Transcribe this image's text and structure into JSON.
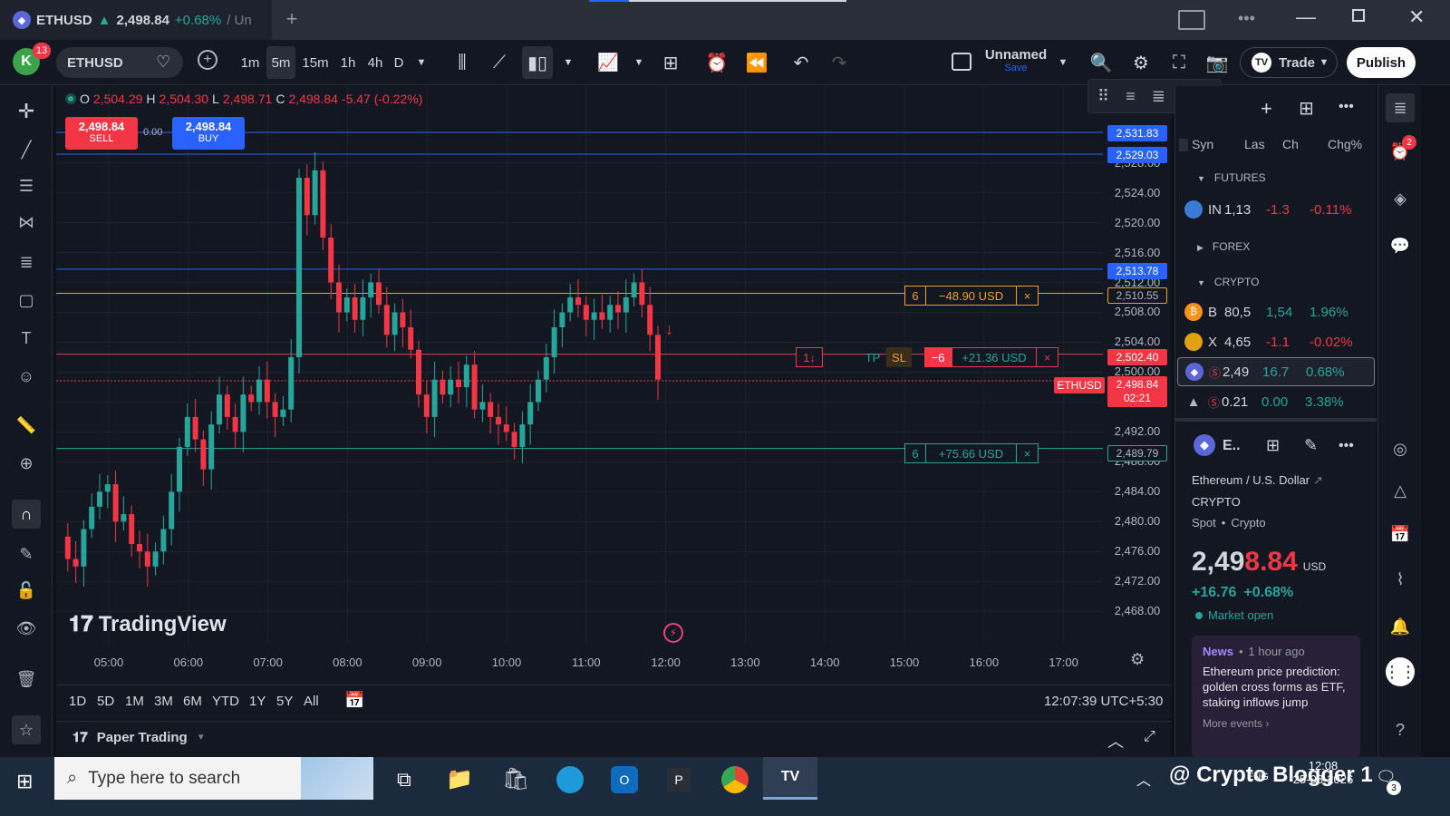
{
  "browser": {
    "tab_symbol": "ETHUSD",
    "tab_arrow": "▲",
    "tab_price": "2,498.84",
    "tab_change": "+0.68%",
    "tab_rest": "/ Un",
    "new_tab": "+"
  },
  "toolbar": {
    "avatar_letter": "K",
    "avatar_badge": "13",
    "symbol": "ETHUSD",
    "intervals": [
      "1m",
      "5m",
      "15m",
      "1h",
      "4h",
      "D"
    ],
    "active_interval": "5m",
    "layout_name": "Unnamed",
    "layout_save": "Save",
    "trade_label": "Trade",
    "publish_label": "Publish"
  },
  "ohlc": {
    "o_label": "O",
    "o": "2,504.29",
    "h_label": "H",
    "h": "2,504.30",
    "l_label": "L",
    "l": "2,498.71",
    "c_label": "C",
    "c": "2,498.84",
    "change": "-5.47 (-0.22%)"
  },
  "quick_trade": {
    "sell_price": "2,498.84",
    "sell_label": "SELL",
    "spread": "0.00",
    "buy_price": "2,498.84",
    "buy_label": "BUY"
  },
  "price_axis": {
    "ticks": [
      "2,528.00",
      "2,524.00",
      "2,520.00",
      "2,516.00",
      "2,512.00",
      "2,508.00",
      "2,504.00",
      "2,500.00",
      "2,496.00",
      "2,492.00",
      "2,488.00",
      "2,484.00",
      "2,480.00",
      "2,476.00",
      "2,472.00",
      "2,468.00"
    ],
    "labels": {
      "line1": "2,531.83",
      "line2": "2,529.03",
      "line3": "2,513.78",
      "tp_order": "2,510.55",
      "position": "2,502.40",
      "last": "2,498.84",
      "countdown": "02:21",
      "sl_order": "2,489.79"
    },
    "symbol_tag": "ETHUSD"
  },
  "orders": {
    "tp": {
      "qty": "6",
      "pnl": "−48.90 USD",
      "close": "×"
    },
    "position": {
      "side_icon": "1↓",
      "tp": "TP",
      "sl": "SL",
      "qty": "−6",
      "pnl": "+21.36 USD",
      "close": "×"
    },
    "sl": {
      "qty": "6",
      "pnl": "+75.66 USD",
      "close": "×"
    }
  },
  "watermark": "TradingView",
  "time_axis": [
    "05:00",
    "06:00",
    "07:00",
    "08:00",
    "09:00",
    "10:00",
    "11:00",
    "12:00",
    "13:00",
    "14:00",
    "15:00",
    "16:00",
    "17:00"
  ],
  "range_bar": {
    "ranges": [
      "1D",
      "5D",
      "1M",
      "3M",
      "6M",
      "YTD",
      "1Y",
      "5Y",
      "All"
    ],
    "clock": "12:07:39 UTC+5:30"
  },
  "bottom_panel": {
    "title": "Paper Trading"
  },
  "watchlist": {
    "columns": [
      "Syn",
      "Las",
      "Ch",
      "Chg%"
    ],
    "sections": {
      "futures": "FUTURES",
      "forex": "FOREX",
      "crypto": "CRYPTO"
    },
    "rows": [
      {
        "sym": "IN",
        "last": "1,13",
        "chg": "-1.3",
        "chgp": "-0.11%",
        "color": "#3a7bd5"
      },
      {
        "sym": "B",
        "last": "80,5",
        "chg": "1,54",
        "chgp": "1.96%",
        "color": "#f7931a"
      },
      {
        "sym": "X",
        "last": "4,65",
        "chg": "-1.1",
        "chgp": "-0.02%",
        "color": "#e0a010"
      },
      {
        "sym": "",
        "last": "2,49",
        "chg": "16.7",
        "chgp": "0.68%",
        "color": "#5b67d6"
      },
      {
        "sym": "",
        "last": "0.21",
        "chg": "0.00",
        "chgp": "3.38%",
        "color": "#2a2e39"
      }
    ]
  },
  "details": {
    "short": "E..",
    "name": "Ethereum / U.S. Dollar",
    "type": "CRYPTO",
    "sub1": "Spot",
    "sub2": "Crypto",
    "price_main": "2,49",
    "price_tail": "8.84",
    "currency": "USD",
    "change": "+16.76",
    "change_pct": "+0.68%",
    "status": "Market open",
    "news_label": "News",
    "news_time": "1 hour ago",
    "news_text": "Ethereum price prediction: golden cross forms as ETF, staking inflows jump",
    "more": "More events"
  },
  "notif_badge": "2",
  "taskbar": {
    "search_placeholder": "Type here to search",
    "time": "12:08",
    "date": "25-08-2026",
    "watermark_text": "@ Crypto Blogger 1",
    "lang": "ENG",
    "badge": "3"
  },
  "colors": {
    "up": "#26a69a",
    "down": "#f23645",
    "accent": "#2962ff",
    "tp_line": "#f0a020",
    "sl_line": "#26a69a",
    "pos_line": "#f23645"
  }
}
